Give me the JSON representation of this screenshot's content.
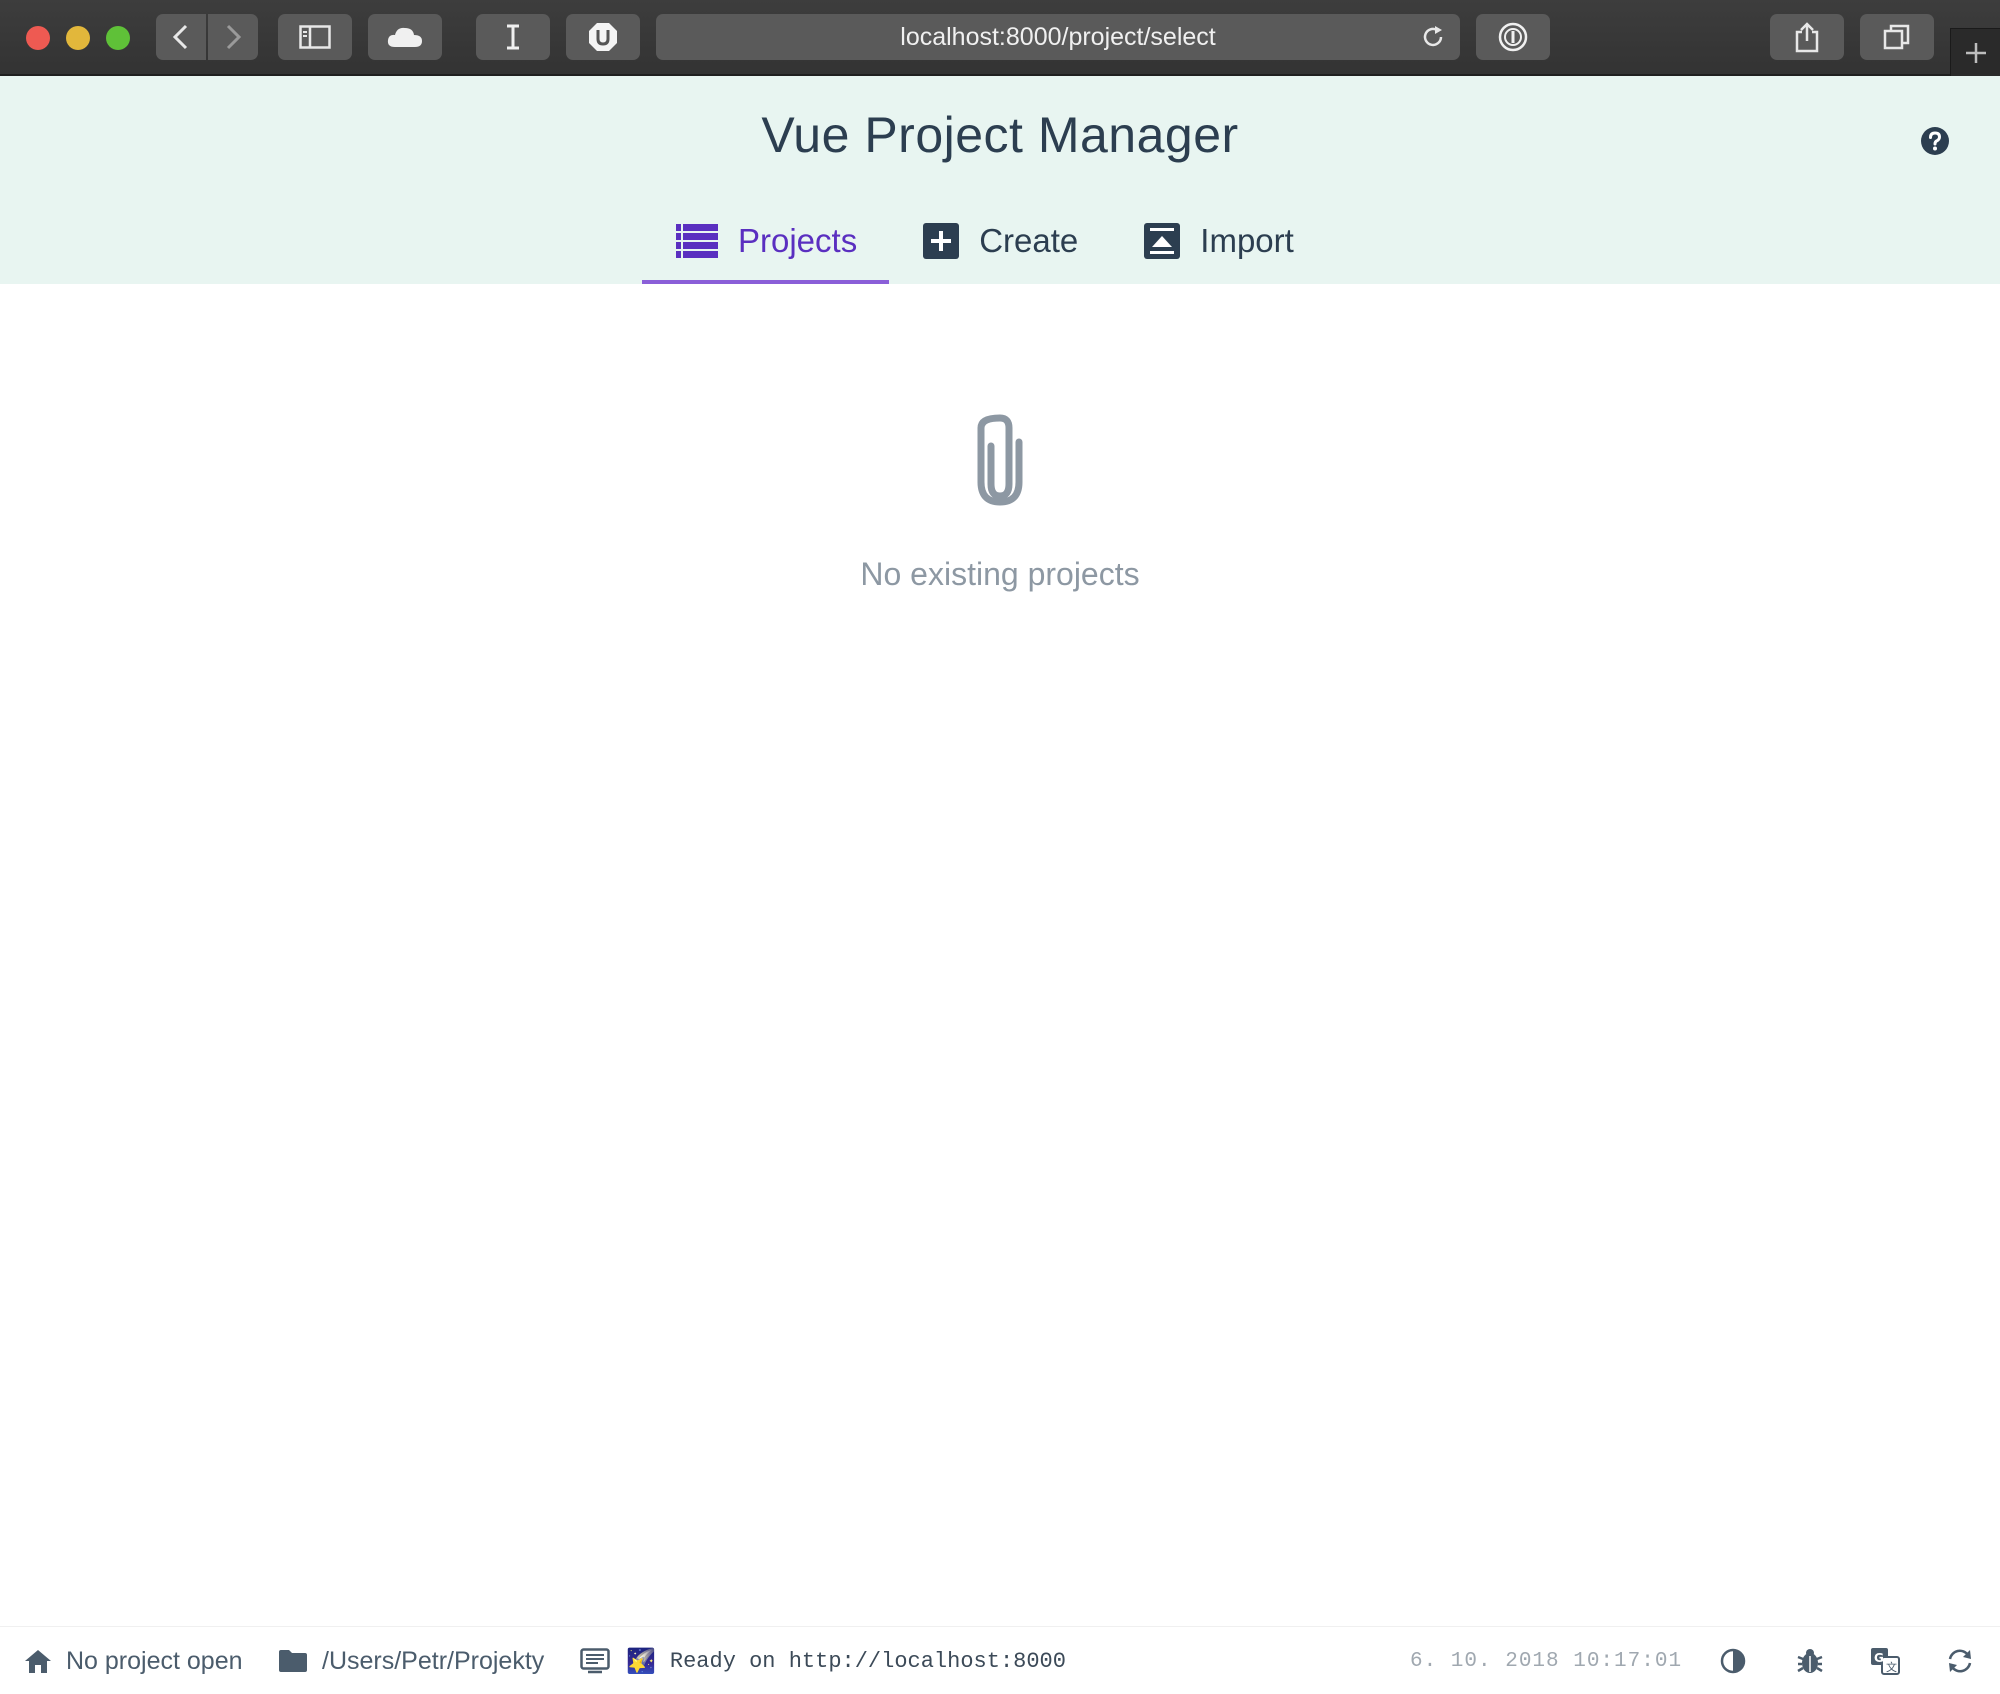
{
  "browser": {
    "url": "localhost:8000/project/select",
    "toolbar_icons": [
      "back-icon",
      "forward-icon",
      "sidebar-icon",
      "cloud-icon",
      "text-cursor-icon",
      "ublock-icon",
      "password-icon",
      "share-icon",
      "tabs-icon",
      "new-tab-icon"
    ]
  },
  "app": {
    "title": "Vue Project Manager",
    "help_icon": "question-circle-icon"
  },
  "tabs": [
    {
      "label": "Projects",
      "icon": "list-icon",
      "active": true
    },
    {
      "label": "Create",
      "icon": "plus-square-icon",
      "active": false
    },
    {
      "label": "Import",
      "icon": "upload-box-icon",
      "active": false
    }
  ],
  "empty_state": {
    "icon": "paperclip-icon",
    "message": "No existing projects"
  },
  "statusbar": {
    "project": "No project open",
    "cwd": "/Users/Petr/Projekty",
    "log_emoji": "🌠",
    "log": "Ready on http://localhost:8000",
    "timestamp": "6. 10. 2018 10:17:01"
  },
  "colors": {
    "header_bg": "#e8f5f1",
    "accent": "#5a2fc0",
    "tab_underline": "#8a5fd8",
    "text": "#2c3e50",
    "muted": "#8d98a3"
  }
}
